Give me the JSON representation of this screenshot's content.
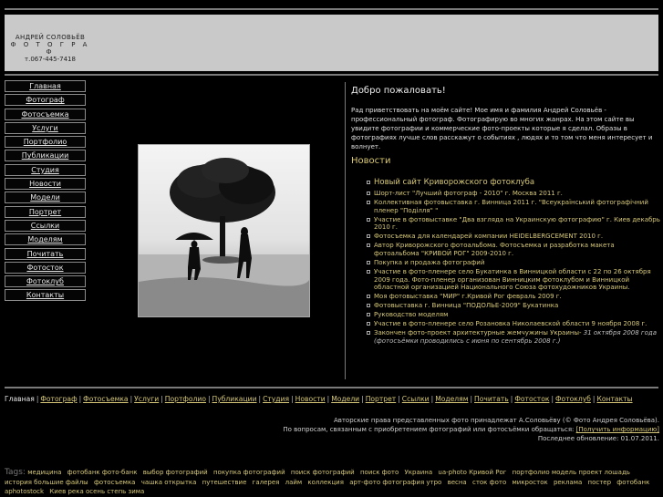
{
  "header": {
    "name": "АНДРЕЙ  СОЛОВЬЁВ",
    "role": "Ф О Т О Г Р А Ф",
    "phone": "т.067-445-7418"
  },
  "menu": [
    "Главная",
    "Фотограф",
    "Фотосъемка",
    "Услуги",
    "Портфолио",
    "Публикации",
    "Студия",
    "Новости",
    "Модели",
    "Портрет",
    "Ссылки",
    "Моделям",
    "Почитать",
    "Фотосток",
    "Фотоклуб",
    "Контакты"
  ],
  "welcome": {
    "title": "Добро пожаловать!",
    "text": "Рад приветствовать на моём сайте! Мое имя и фамилия  Андрей Соловьёв - профессиональный фотограф. Фотографирую во многих жанрах. На этом сайте вы увидите  фотографии и коммерческие фото-проекты которые я сделал. Образы в фотографиях лучше слов  расскажут о событиях , людях и то том что меня интересует и волнует."
  },
  "news": {
    "title": "Новости",
    "items": [
      {
        "text": "Новый сайт Криворожского фотоклуба"
      },
      {
        "text": "Шорт-лист \"Лучший фотограф - 2010\" г. Москва 2011 г."
      },
      {
        "text": "Коллективная фотовыставка г. Винница 2011 г. \"Всеукраїнський фотографічний пленер \"Поділля\" \""
      },
      {
        "text": "Участие в фотовыставке \"Два взгляда на Украинскую фотографию\" г.  Киев декабрь 2010 г."
      },
      {
        "text": "Фотосъемка для календарей компании HEIDELBERGCEMENT 2010 г."
      },
      {
        "text": "Автор Криворожского фотоальбома. Фотосъемка и разработка макета фотоальбома \"КРИВОЙ РОГ\" 2009-2010 г."
      },
      {
        "text": "Покупка и продажа фотографий"
      },
      {
        "text": "Участие в фото-пленере село Букатинка в Винницкой области с 22 по 26 октября 2009 года. Фото-пленер организован Винницким фотоклубом и Винницкой областной организацией Национального Союза  фотохудожников Украины."
      },
      {
        "text": "Моя фотовыставка \"МИР\" г.Кривой Рог февраль 2009 г."
      },
      {
        "text": "Фотовыставка г. Винница \"ПОДОЛЬЕ-2009\" Букатинка"
      },
      {
        "text": "Руководство моделям"
      },
      {
        "text": "Участие в фото-пленере село Розановка Николаевской области 9 ноября 2008 г."
      },
      {
        "text": "Закончен фото-проект архитектурные жемчужины Украины- ",
        "date": "31 октября 2008 года (фотосъёмки проводились с июня по сентябрь 2008 г.)"
      }
    ]
  },
  "footer_nav": [
    "Главная",
    "Фотограф",
    "Фотосъемка",
    "Услуги",
    "Портфолио",
    "Публикации",
    "Студия",
    "Новости",
    "Модели",
    "Портрет",
    "Ссылки",
    "Моделям",
    "Почитать",
    "Фотосток",
    "Фотоклуб",
    "Контакты"
  ],
  "copyright": {
    "line1": "Авторские права представленных фото принадлежат А.Соловьёву (© Фото Андрея Соловьёва).",
    "line2": "По вопросам, связанным с приобретением фотографий или фотосъёмки обращаться:",
    "link": "[Получить информацию]",
    "updated_label": "Последнее обновление:",
    "updated": "01.07.2011"
  },
  "tags": {
    "label": "Tags:",
    "items": [
      "медицина",
      "фотобанк фото-банк",
      "выбор фотографий",
      "покупка фотографий",
      "поиск фотографий",
      "поиск фото",
      "Украина",
      "ua-photo Кривой Рог",
      "портфолио модель проект лошадь",
      "история большие файлы",
      "фотосъемка",
      "чашка открытка",
      "путешествие",
      "галерея",
      "лайм",
      "коллекция",
      "арт-фото фотография утро",
      "весна",
      "сток фото",
      "микросток",
      "реклама",
      "постер",
      "фотобанк",
      "aphotostock",
      "Киев река осень степь зима"
    ]
  },
  "colors": {
    "link": "#d6c878",
    "banner": "#c9c9c9",
    "background": "#000000"
  }
}
